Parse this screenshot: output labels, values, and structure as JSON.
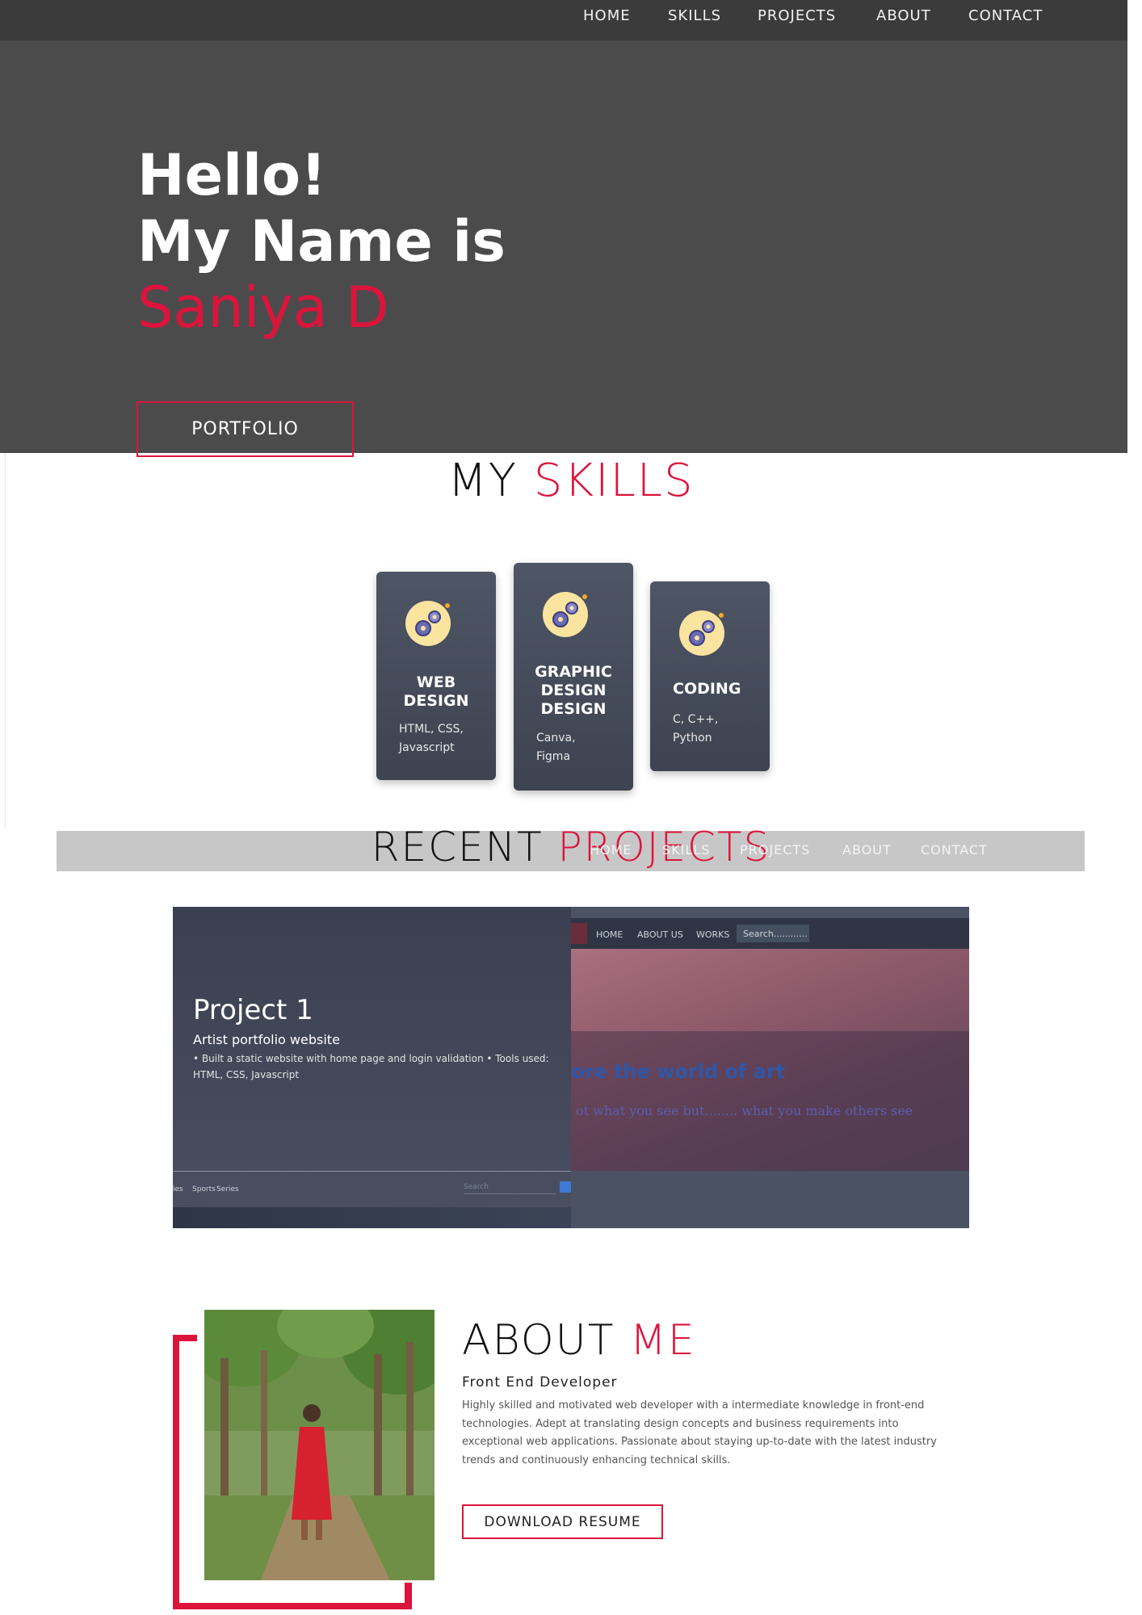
{
  "nav": {
    "items": [
      "HOME",
      "SKILLS",
      "PROJECTS",
      "ABOUT",
      "CONTACT"
    ]
  },
  "hero": {
    "line1": "Hello!",
    "line2": "My Name is",
    "name": "Saniya D",
    "button": "PORTFOLIO"
  },
  "skills": {
    "title_part1": "MY",
    "title_part2": "SKILLS",
    "cards": [
      {
        "title_line1": "WEB",
        "title_line2": "DESIGN",
        "desc_line1": "HTML, CSS,",
        "desc_line2": "Javascript",
        "icon": "gears-icon"
      },
      {
        "title_line1": "GRAPHIC",
        "title_line2": "DESIGN",
        "title_line3": "DESIGN",
        "desc_line1": "Canva,",
        "desc_line2": "Figma",
        "icon": "gears-icon"
      },
      {
        "title_line1": "CODING",
        "desc_line1": "C, C++,",
        "desc_line2": "Python",
        "icon": "gears-icon"
      }
    ]
  },
  "band_nav": {
    "items": [
      "HOME",
      "SKILLS",
      "PROJECTS",
      "ABOUT",
      "CONTACT"
    ]
  },
  "projects": {
    "title_part1": "RECENT",
    "title_part2": "PROJECTS",
    "items": [
      {
        "title": "Project 1",
        "subtitle": "Artist portfolio website",
        "description": "• Built a static website with home page and login validation • Tools used: HTML, CSS, Javascript",
        "preview": {
          "nav": [
            "HOME",
            "ABOUT US",
            "WORKS"
          ],
          "search_placeholder": "Search............",
          "heading": "ore the world of art",
          "tagline": "ot what you see but........ what you make others see",
          "bottom_links": [
            "ies",
            "Sports",
            "Series"
          ],
          "bottom_search": "Search"
        }
      }
    ]
  },
  "about": {
    "title_part1": "ABOUT",
    "title_part2": "ME",
    "role": "Front End Developer",
    "description": "Highly skilled and motivated web developer with a intermediate knowledge in front-end technologies. Adept at translating design concepts and business requirements into exceptional web applications. Passionate about staying up-to-date with the latest industry trends and continuously enhancing technical skills.",
    "button": "DOWNLOAD RESUME"
  },
  "colors": {
    "accent": "#dc143c",
    "nav_bg": "#3b3b3b",
    "hero_bg": "#4b4b4c",
    "card_bg": "#4a5060"
  }
}
